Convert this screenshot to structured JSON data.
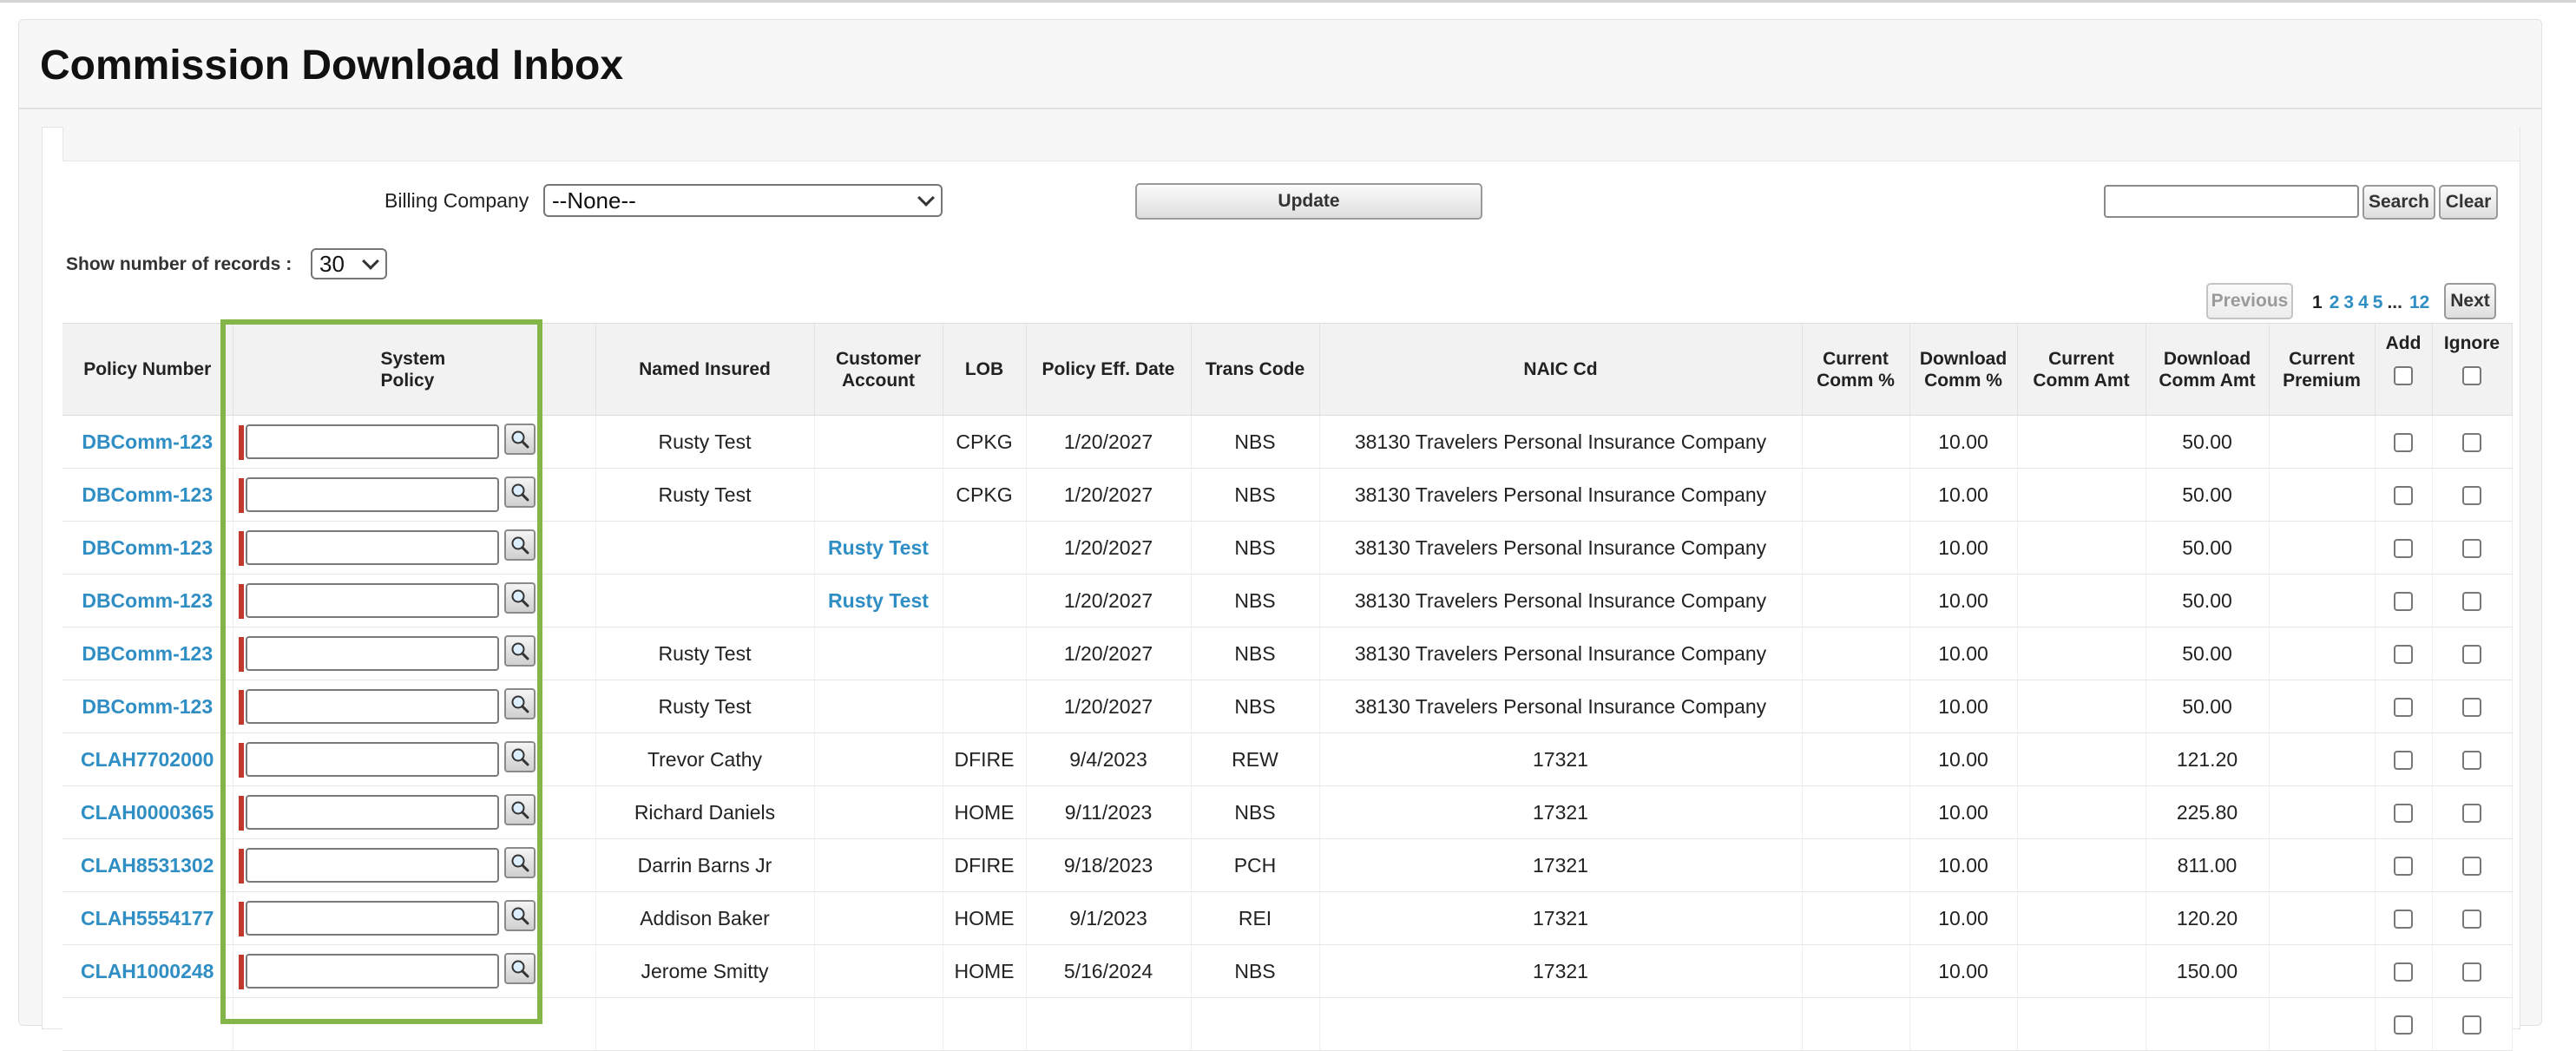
{
  "page": {
    "title": "Commission Download Inbox"
  },
  "filters": {
    "billing_company_label": "Billing Company",
    "billing_company_value": "--None--",
    "update_label": "Update",
    "search_value": "",
    "search_label": "Search",
    "clear_label": "Clear",
    "records_label": "Show number of records :",
    "records_value": "30"
  },
  "pagination": {
    "previous_label": "Previous",
    "current_page": "1",
    "pages": [
      "2",
      "3",
      "4",
      "5"
    ],
    "ellipsis": "...",
    "last_page": "12",
    "next_label": "Next"
  },
  "table": {
    "headers": {
      "policy_number": "Policy Number",
      "system_policy_line1": "System",
      "system_policy_line2": "Policy",
      "named_insured": "Named Insured",
      "customer_account_line1": "Customer",
      "customer_account_line2": "Account",
      "lob": "LOB",
      "policy_eff_date": "Policy Eff. Date",
      "trans_code": "Trans Code",
      "naic_cd": "NAIC Cd",
      "current_comm_pct_line1": "Current",
      "current_comm_pct_line2": "Comm %",
      "download_comm_pct_line1": "Download",
      "download_comm_pct_line2": "Comm %",
      "current_comm_amt_line1": "Current",
      "current_comm_amt_line2": "Comm Amt",
      "download_comm_amt_line1": "Download",
      "download_comm_amt_line2": "Comm Amt",
      "current_premium_line1": "Current",
      "current_premium_line2": "Premium",
      "add": "Add",
      "ignore": "Ignore"
    },
    "rows": [
      {
        "policy_number": "DBComm-123",
        "named_insured": "Rusty Test",
        "customer_account": "",
        "lob": "CPKG",
        "eff_date": "1/20/2027",
        "trans_code": "NBS",
        "naic": "38130 Travelers Personal Insurance Company",
        "current_comm_pct": "",
        "download_comm_pct": "10.00",
        "current_comm_amt": "",
        "download_comm_amt": "50.00",
        "current_premium": ""
      },
      {
        "policy_number": "DBComm-123",
        "named_insured": "Rusty Test",
        "customer_account": "",
        "lob": "CPKG",
        "eff_date": "1/20/2027",
        "trans_code": "NBS",
        "naic": "38130 Travelers Personal Insurance Company",
        "current_comm_pct": "",
        "download_comm_pct": "10.00",
        "current_comm_amt": "",
        "download_comm_amt": "50.00",
        "current_premium": ""
      },
      {
        "policy_number": "DBComm-123",
        "named_insured": "",
        "customer_account": "Rusty Test",
        "lob": "",
        "eff_date": "1/20/2027",
        "trans_code": "NBS",
        "naic": "38130 Travelers Personal Insurance Company",
        "current_comm_pct": "",
        "download_comm_pct": "10.00",
        "current_comm_amt": "",
        "download_comm_amt": "50.00",
        "current_premium": ""
      },
      {
        "policy_number": "DBComm-123",
        "named_insured": "",
        "customer_account": "Rusty Test",
        "lob": "",
        "eff_date": "1/20/2027",
        "trans_code": "NBS",
        "naic": "38130 Travelers Personal Insurance Company",
        "current_comm_pct": "",
        "download_comm_pct": "10.00",
        "current_comm_amt": "",
        "download_comm_amt": "50.00",
        "current_premium": ""
      },
      {
        "policy_number": "DBComm-123",
        "named_insured": "Rusty Test",
        "customer_account": "",
        "lob": "",
        "eff_date": "1/20/2027",
        "trans_code": "NBS",
        "naic": "38130 Travelers Personal Insurance Company",
        "current_comm_pct": "",
        "download_comm_pct": "10.00",
        "current_comm_amt": "",
        "download_comm_amt": "50.00",
        "current_premium": ""
      },
      {
        "policy_number": "DBComm-123",
        "named_insured": "Rusty Test",
        "customer_account": "",
        "lob": "",
        "eff_date": "1/20/2027",
        "trans_code": "NBS",
        "naic": "38130 Travelers Personal Insurance Company",
        "current_comm_pct": "",
        "download_comm_pct": "10.00",
        "current_comm_amt": "",
        "download_comm_amt": "50.00",
        "current_premium": ""
      },
      {
        "policy_number": "CLAH7702000",
        "named_insured": "Trevor Cathy",
        "customer_account": "",
        "lob": "DFIRE",
        "eff_date": "9/4/2023",
        "trans_code": "REW",
        "naic": "17321",
        "current_comm_pct": "",
        "download_comm_pct": "10.00",
        "current_comm_amt": "",
        "download_comm_amt": "121.20",
        "current_premium": ""
      },
      {
        "policy_number": "CLAH0000365",
        "named_insured": "Richard Daniels",
        "customer_account": "",
        "lob": "HOME",
        "eff_date": "9/11/2023",
        "trans_code": "NBS",
        "naic": "17321",
        "current_comm_pct": "",
        "download_comm_pct": "10.00",
        "current_comm_amt": "",
        "download_comm_amt": "225.80",
        "current_premium": ""
      },
      {
        "policy_number": "CLAH8531302",
        "named_insured": "Darrin Barns Jr",
        "customer_account": "",
        "lob": "DFIRE",
        "eff_date": "9/18/2023",
        "trans_code": "PCH",
        "naic": "17321",
        "current_comm_pct": "",
        "download_comm_pct": "10.00",
        "current_comm_amt": "",
        "download_comm_amt": "811.00",
        "current_premium": ""
      },
      {
        "policy_number": "CLAH5554177",
        "named_insured": "Addison Baker",
        "customer_account": "",
        "lob": "HOME",
        "eff_date": "9/1/2023",
        "trans_code": "REI",
        "naic": "17321",
        "current_comm_pct": "",
        "download_comm_pct": "10.00",
        "current_comm_amt": "",
        "download_comm_amt": "120.20",
        "current_premium": ""
      },
      {
        "policy_number": "CLAH1000248",
        "named_insured": "Jerome Smitty",
        "customer_account": "",
        "lob": "HOME",
        "eff_date": "5/16/2024",
        "trans_code": "NBS",
        "naic": "17321",
        "current_comm_pct": "",
        "download_comm_pct": "10.00",
        "current_comm_amt": "",
        "download_comm_amt": "150.00",
        "current_premium": ""
      }
    ]
  },
  "colors": {
    "link": "#2f8ec4",
    "highlight_border": "#84b548",
    "required_marker": "#c0392b",
    "header_bg": "#f2f2f2"
  },
  "icons": {
    "lookup": "magnifier-lookup-icon",
    "dropdown": "chevron-down-icon"
  }
}
